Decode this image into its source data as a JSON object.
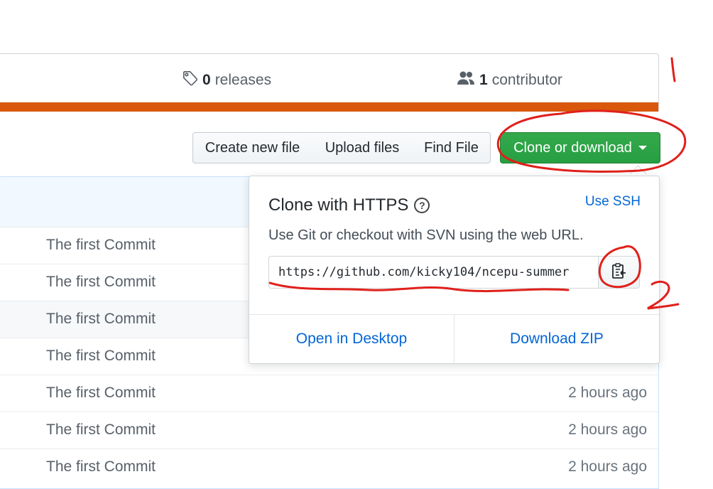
{
  "summary": {
    "releases_count": "0",
    "releases_label": "releases",
    "contributors_count": "1",
    "contributors_label": "contributor",
    "language_color": "#d9580b"
  },
  "toolbar": {
    "create_file": "Create new file",
    "upload_files": "Upload files",
    "find_file": "Find File",
    "clone_download": "Clone or download"
  },
  "clone_popover": {
    "title": "Clone with HTTPS",
    "use_ssh": "Use SSH",
    "description": "Use Git or checkout with SVN using the web URL.",
    "url": "https://github.com/kicky104/ncepu-summer",
    "open_desktop": "Open in Desktop",
    "download_zip": "Download ZIP"
  },
  "files": [
    {
      "message": "The first Commit",
      "age": ""
    },
    {
      "message": "The first Commit",
      "age": ""
    },
    {
      "message": "The first Commit",
      "age": ""
    },
    {
      "message": "The first Commit",
      "age": ""
    },
    {
      "message": "The first Commit",
      "age": "2 hours ago"
    },
    {
      "message": "The first Commit",
      "age": "2 hours ago"
    },
    {
      "message": "The first Commit",
      "age": "2 hours ago"
    }
  ],
  "colors": {
    "primary_button": "#2ea44f",
    "link": "#0366d6",
    "annotation": "#e0201b"
  }
}
